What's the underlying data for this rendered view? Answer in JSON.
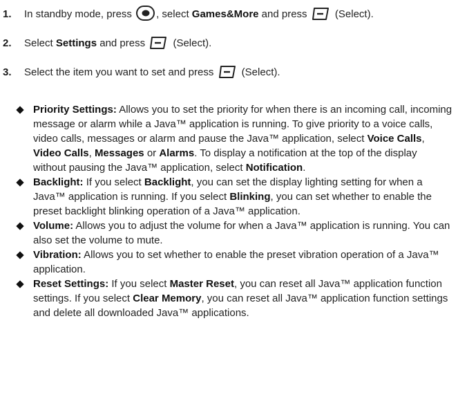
{
  "steps": [
    {
      "num": "1.",
      "t1": "In standby mode, press",
      "t2": ", select",
      "b1": "Games&More",
      "t3": "and press",
      "t4": "(Select)."
    },
    {
      "num": "2.",
      "t1": "Select",
      "b1": "Settings",
      "t2": "and press",
      "t3": "(Select)."
    },
    {
      "num": "3.",
      "t1": "Select the item you want to set and press",
      "t2": "(Select)."
    }
  ],
  "bullets": [
    {
      "term": "Priority Settings:",
      "p1": "Allows you to set the priority for when there is an incoming call, incoming message or alarm while a Java™ application is running. To give priority to a voice calls, video calls, messages or alarm and pause the Java™ application, select",
      "b1": "Voice Calls",
      "s1": ",",
      "b2": "Video Calls",
      "s2": ",",
      "b3": "Messages",
      "s3": "or",
      "b4": "Alarms",
      "p2": ". To display a notification at the top of the display without pausing the Java™ application, select",
      "b5": "Notification",
      "p3": "."
    },
    {
      "term": "Backlight:",
      "p1": "If you select",
      "b1": "Backlight",
      "p2": ", you can set the display lighting setting for when a Java™ application is running. If you select",
      "b2": "Blinking",
      "p3": ", you can set whether to enable the preset backlight blinking operation of a Java™ application."
    },
    {
      "term": "Volume:",
      "p1": "Allows you to adjust the volume for when a Java™ application is running. You can also set the volume to mute."
    },
    {
      "term": "Vibration:",
      "p1": "Allows you to set whether to enable the preset vibration operation of a Java™ application."
    },
    {
      "term": "Reset Settings:",
      "p1": "If you select",
      "b1": "Master Reset",
      "p2": ", you can reset all Java™ application function settings. If you select",
      "b2": "Clear Memory",
      "p3": ", you can reset all Java™ application function settings and delete all downloaded Java™ applications."
    }
  ],
  "icons": {
    "center_key": "center-select-key-icon",
    "soft_key": "left-soft-key-icon"
  }
}
